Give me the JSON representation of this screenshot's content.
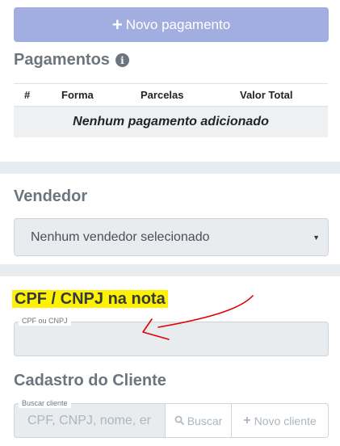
{
  "payments": {
    "new_button_label": "Novo pagamento",
    "title": "Pagamentos",
    "columns": [
      "#",
      "Forma",
      "Parcelas",
      "Valor Total"
    ],
    "empty_text": "Nenhum pagamento adicionado"
  },
  "vendor": {
    "title": "Vendedor",
    "selected": "Nenhum vendedor selecionado"
  },
  "cpf_note": {
    "title": "CPF / CNPJ na nota",
    "label": "CPF ou CNPJ",
    "value": ""
  },
  "client": {
    "title": "Cadastro do Cliente",
    "search_label": "Buscar cliente",
    "search_placeholder": "CPF, CNPJ, nome, er",
    "search_button": "Buscar",
    "new_client_button": "Novo cliente"
  },
  "colors": {
    "primary_disabled": "#a3aee0",
    "highlight": "#fff200",
    "annotation": "#e00000"
  }
}
